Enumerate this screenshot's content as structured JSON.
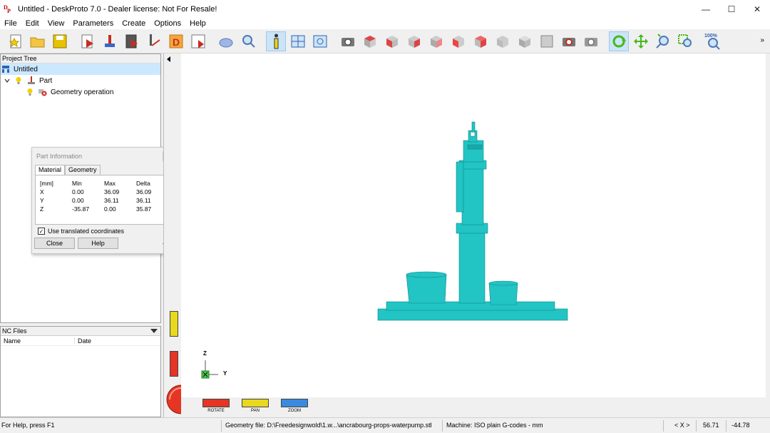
{
  "window": {
    "title": "Untitled - DeskProto 7.0 - Dealer license: Not For Resale!",
    "app_icon_text": "DP",
    "controls": {
      "minimize": "—",
      "maximize": "☐",
      "close": "✕"
    }
  },
  "menu": [
    "File",
    "Edit",
    "View",
    "Parameters",
    "Create",
    "Options",
    "Help"
  ],
  "toolbar": {
    "zoom_label": "100%",
    "more": "»"
  },
  "project_tree": {
    "header": "Project Tree",
    "root": "Untitled",
    "part": "Part",
    "operation": "Geometry operation"
  },
  "nc_files": {
    "header": "NC Files",
    "col_name": "Name",
    "col_date": "Date"
  },
  "part_info": {
    "title": "Part Information",
    "tabs": [
      "Material",
      "Geometry"
    ],
    "header": [
      "[mm]",
      "Min",
      "Max",
      "Delta"
    ],
    "rows": [
      [
        "X",
        "0.00",
        "36.09",
        "36.09"
      ],
      [
        "Y",
        "0.00",
        "36.11",
        "36.11"
      ],
      [
        "Z",
        "-35.87",
        "0.00",
        "35.87"
      ]
    ],
    "checkbox_label": "Use translated coordinates",
    "checkbox_checked": true,
    "close_label": "Close",
    "help_label": "Help"
  },
  "view_modes": {
    "rotate": "ROTATE",
    "pan": "PAN",
    "zoom": "ZOOM"
  },
  "axes": {
    "z": "Z",
    "y": "Y"
  },
  "status": {
    "help": "For Help, press F1",
    "geometry_file": "Geometry file: D:\\Freedesignwold\\1.w...\\ancrabourg-props-waterpump.stl",
    "machine": "Machine: ISO plain G-codes - mm",
    "axis_hint": "< X >",
    "coord_x": "56.71",
    "coord_y": "-44.78"
  },
  "colors": {
    "model": "#22c4c4",
    "rotate": "#e53524",
    "pan": "#e8d81e",
    "zoom": "#3a8ae0",
    "accent_selection": "#cce8ff"
  }
}
